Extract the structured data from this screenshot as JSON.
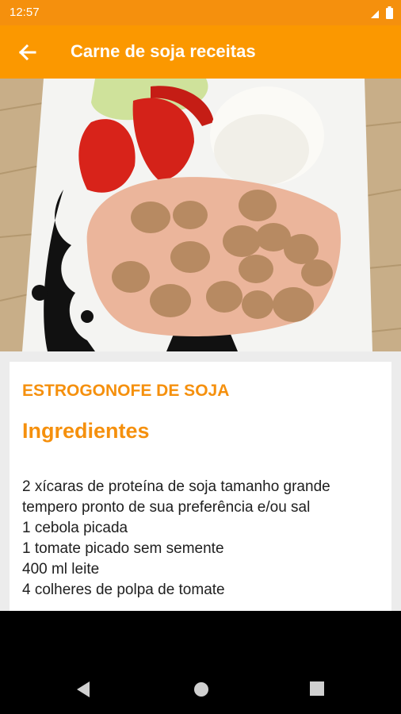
{
  "status_bar": {
    "time": "12:57",
    "icons": [
      "wifi-icon",
      "battery-icon"
    ]
  },
  "app_bar": {
    "title": "Carne de soja receitas",
    "back_icon": "arrow-back-icon",
    "color": "#fb9800"
  },
  "recipe": {
    "name": "ESTROGONOFE DE SOJA",
    "section_title": "Ingredientes",
    "ingredients": [
      "2 xícaras de proteína de soja tamanho grande",
      "tempero pronto de sua preferência e/ou sal",
      "1 cebola picada",
      "1 tomate picado sem semente",
      "400 ml leite",
      "4 colheres de polpa de tomate"
    ],
    "accent_color": "#f5900d"
  },
  "navigation_bar": {
    "buttons": [
      "back-triangle-icon",
      "home-circle-icon",
      "recents-square-icon"
    ]
  }
}
